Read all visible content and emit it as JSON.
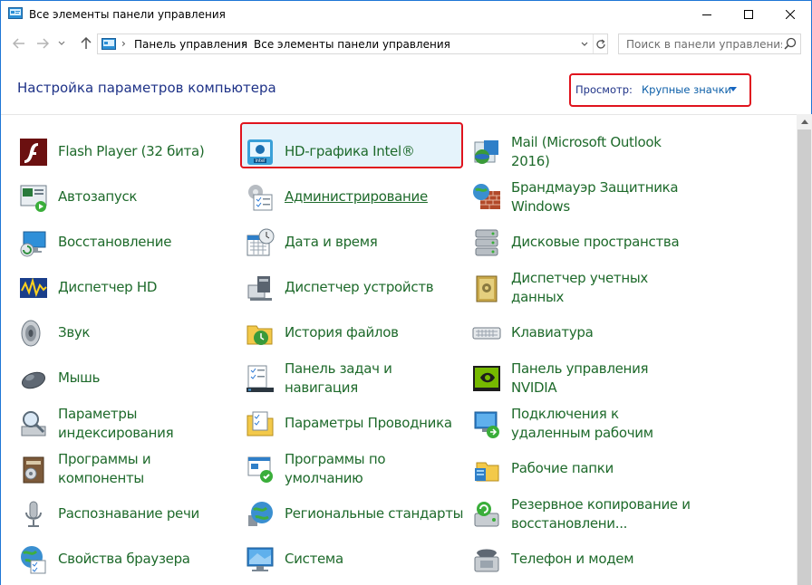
{
  "window": {
    "title": "Все элементы панели управления"
  },
  "address": {
    "breadcrumbs": [
      "Панель управления",
      "Все элементы панели управления"
    ]
  },
  "search": {
    "placeholder": "Поиск в панели управления"
  },
  "header": {
    "title": "Настройка параметров компьютера",
    "view_label": "Просмотр:",
    "view_value": "Крупные значки"
  },
  "colors": {
    "link": "#1e6a2b",
    "title": "#1e3287",
    "highlight": "#e0141e",
    "accent": "#1e76d6"
  },
  "items": [
    {
      "label": "Flash Player (32 бита)",
      "icon": "flash-player-icon"
    },
    {
      "label": "HD-графика Intel®",
      "icon": "intel-graphics-icon"
    },
    {
      "label": "Mail (Microsoft Outlook 2016)",
      "icon": "mail-icon"
    },
    {
      "label": "Автозапуск",
      "icon": "autoplay-icon"
    },
    {
      "label": "Администрирование",
      "icon": "administration-icon"
    },
    {
      "label": "Брандмауэр Защитника Windows",
      "icon": "firewall-icon"
    },
    {
      "label": "Восстановление",
      "icon": "recovery-icon"
    },
    {
      "label": "Дата и время",
      "icon": "date-time-icon"
    },
    {
      "label": "Дисковые пространства",
      "icon": "storage-spaces-icon"
    },
    {
      "label": "Диспетчер HD",
      "icon": "hd-audio-manager-icon"
    },
    {
      "label": "Диспетчер устройств",
      "icon": "device-manager-icon"
    },
    {
      "label": "Диспетчер учетных данных",
      "icon": "credential-manager-icon"
    },
    {
      "label": "Звук",
      "icon": "sound-icon"
    },
    {
      "label": "История файлов",
      "icon": "file-history-icon"
    },
    {
      "label": "Клавиатура",
      "icon": "keyboard-icon"
    },
    {
      "label": "Мышь",
      "icon": "mouse-icon"
    },
    {
      "label": "Панель задач и навигация",
      "icon": "taskbar-icon"
    },
    {
      "label": "Панель управления NVIDIA",
      "icon": "nvidia-icon"
    },
    {
      "label": "Параметры индексирования",
      "icon": "indexing-icon"
    },
    {
      "label": "Параметры Проводника",
      "icon": "explorer-options-icon"
    },
    {
      "label": "Подключения к удаленным рабочим",
      "icon": "remote-desktop-icon"
    },
    {
      "label": "Программы и компоненты",
      "icon": "programs-features-icon"
    },
    {
      "label": "Программы по умолчанию",
      "icon": "default-programs-icon"
    },
    {
      "label": "Рабочие папки",
      "icon": "work-folders-icon"
    },
    {
      "label": "Распознавание речи",
      "icon": "speech-recognition-icon"
    },
    {
      "label": "Региональные стандарты",
      "icon": "region-icon"
    },
    {
      "label": "Резервное копирование и восстановлени...",
      "icon": "backup-restore-icon"
    },
    {
      "label": "Свойства браузера",
      "icon": "internet-options-icon"
    },
    {
      "label": "Система",
      "icon": "system-icon"
    },
    {
      "label": "Телефон и модем",
      "icon": "phone-modem-icon"
    }
  ]
}
